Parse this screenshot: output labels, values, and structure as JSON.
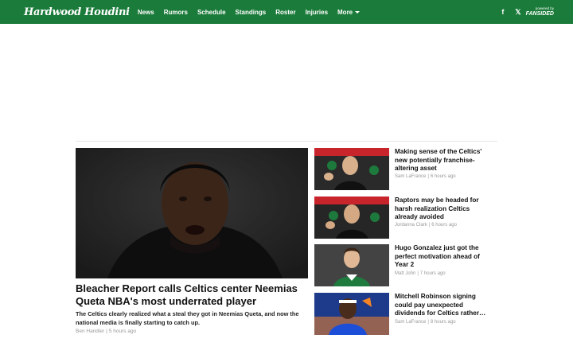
{
  "header": {
    "logo": "Hardwood Houdini",
    "nav": [
      {
        "label": "News"
      },
      {
        "label": "Rumors"
      },
      {
        "label": "Schedule"
      },
      {
        "label": "Standings"
      },
      {
        "label": "Roster"
      },
      {
        "label": "Injuries"
      },
      {
        "label": "More"
      }
    ],
    "powered_by": "powered by",
    "powered_brand": "FANSIDED",
    "facebook_glyph": "f",
    "x_glyph": "𝕏"
  },
  "featured": {
    "title": "Bleacher Report calls Celtics center Neemias Queta NBA's most underrated player",
    "description": "The Celtics clearly realized what a steal they got in Neemias Queta, and now the national media is finally starting to catch up.",
    "author": "Ben Handler",
    "time": "5 hours ago"
  },
  "articles": [
    {
      "title": "Making sense of the Celtics' new potentially franchise-altering asset",
      "author": "Sam LaFrance",
      "time": "6 hours ago"
    },
    {
      "title": "Raptors may be headed for harsh realization Celtics already avoided",
      "author": "Jordanna Clark",
      "time": "6 hours ago"
    },
    {
      "title": "Hugo Gonzalez just got the perfect motivation ahead of Year 2",
      "author": "Matt John",
      "time": "7 hours ago"
    },
    {
      "title": "Mitchell Robinson signing could pay unexpected dividends for Celtics rather…",
      "author": "Sam LaFrance",
      "time": "8 hours ago"
    }
  ],
  "colors": {
    "brand": "#1a7b3a"
  }
}
